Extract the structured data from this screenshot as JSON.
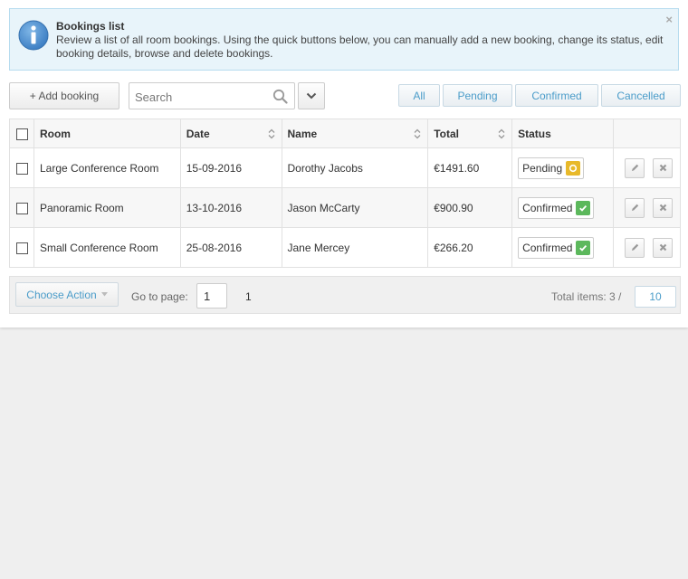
{
  "info": {
    "title": "Bookings list",
    "text": "Review a list of all room bookings. Using the quick buttons below, you can manually add a new booking, change its status, edit booking details, browse and delete bookings.",
    "close_glyph": "×"
  },
  "toolbar": {
    "add_label": "+ Add booking",
    "search_placeholder": "Search",
    "filters": [
      "All",
      "Pending",
      "Confirmed",
      "Cancelled"
    ]
  },
  "table": {
    "headers": {
      "room": "Room",
      "date": "Date",
      "name": "Name",
      "total": "Total",
      "status": "Status"
    },
    "rows": [
      {
        "room": "Large Conference Room",
        "date": "15-09-2016",
        "name": "Dorothy Jacobs",
        "total": "€1491.60",
        "status": "Pending"
      },
      {
        "room": "Panoramic Room",
        "date": "13-10-2016",
        "name": "Jason McCarty",
        "total": "€900.90",
        "status": "Confirmed"
      },
      {
        "room": "Small Conference Room",
        "date": "25-08-2016",
        "name": "Jane Mercey",
        "total": "€266.20",
        "status": "Confirmed"
      }
    ]
  },
  "footer": {
    "action_label": "Choose Action",
    "goto_label": "Go to page:",
    "goto_value": "1",
    "page_number": "1",
    "total_label": "Total items: 3 /",
    "per_page": "10"
  },
  "colors": {
    "accent": "#4a9cc9",
    "pending": "#e8b92a",
    "confirmed": "#5cb85c"
  }
}
